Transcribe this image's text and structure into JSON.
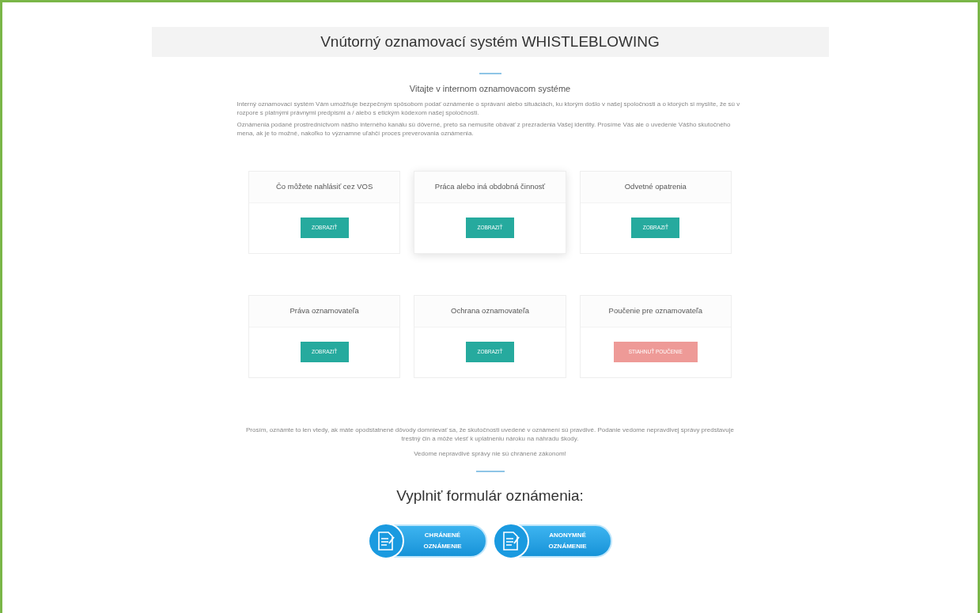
{
  "header": {
    "title": "Vnútorný oznamovací systém WHISTLEBLOWING"
  },
  "intro": {
    "heading": "Vitajte v internom oznamovacom systéme",
    "paragraphs": [
      "Interný oznamovací systém Vám umožňuje bezpečným spôsobom podať oznámenie o správaní alebo situáciách, ku ktorým došlo v našej spoločnosti a o ktorých si myslíte, že sú v rozpore s platnými právnymi predpismi a / alebo s etickým kódexom našej spoločnosti.",
      "Oznámenia podané prostredníctvom nášho interného kanálu sú dôverné, preto sa nemusíte obávať z prezradenia Vašej identity. Prosíme Vás ale o uvedenie Vášho skutočného mena, ak je to možné, nakoľko to významne uľahčí proces preverovania oznámenia."
    ]
  },
  "cards": [
    {
      "title": "Čo môžete nahlásiť cez VOS",
      "button": "ZOBRAZIŤ",
      "kind": "view",
      "highlighted": false
    },
    {
      "title": "Práca alebo iná obdobná činnosť",
      "button": "ZOBRAZIŤ",
      "kind": "view",
      "highlighted": true
    },
    {
      "title": "Odvetné opatrenia",
      "button": "ZOBRAZIŤ",
      "kind": "view",
      "highlighted": false
    },
    {
      "title": "Práva oznamovateľa",
      "button": "ZOBRAZIŤ",
      "kind": "view",
      "highlighted": false
    },
    {
      "title": "Ochrana oznamovateľa",
      "button": "ZOBRAZIŤ",
      "kind": "view",
      "highlighted": false
    },
    {
      "title": "Poučenie pre oznamovateľa",
      "button": "STIAHNUŤ POUČENIE",
      "kind": "download",
      "highlighted": false
    }
  ],
  "warning": [
    "Prosím, oznámte to len vtedy, ak máte opodstatnené dôvody domnievať sa, že skutočnosti uvedené v oznámení sú pravdivé. Podanie vedome nepravdivej správy predstavuje trestný čin a môže viesť k uplatneniu nároku na náhradu škody.",
    "Vedome nepravdivé správy nie sú chránené zákonom!"
  ],
  "form": {
    "heading": "Vyplniť formulár oznámenia:",
    "buttons": [
      {
        "line1": "CHRÁNENÉ",
        "line2": "OZNÁMENIE"
      },
      {
        "line1": "ANONYMNÉ",
        "line2": "OZNÁMENIE"
      }
    ]
  }
}
